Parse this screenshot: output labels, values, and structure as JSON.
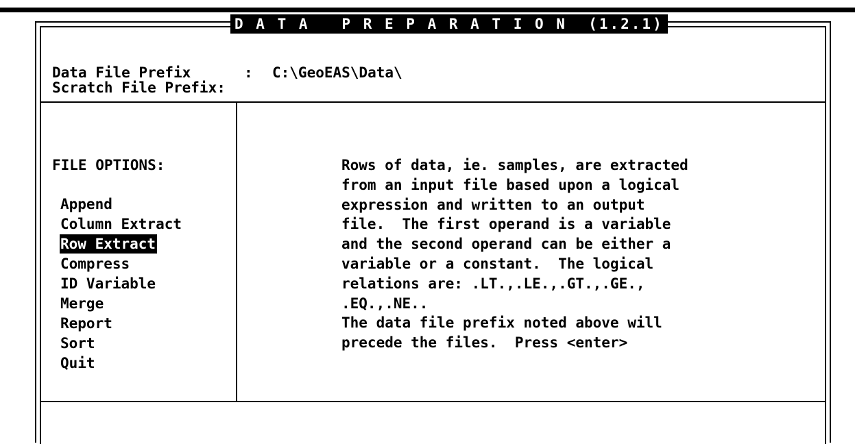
{
  "window": {
    "title": "D A T A   P R E P A R A T I O N  (1.2.1)"
  },
  "header": {
    "data_file_prefix_label": "Data File Prefix",
    "data_file_prefix_separator": ":",
    "data_file_prefix_value": "C:\\GeoEAS\\Data\\",
    "scratch_file_prefix_label": "Scratch File Prefix:",
    "scratch_file_prefix_value": ""
  },
  "file_options": {
    "heading": "FILE OPTIONS:",
    "items": [
      {
        "label": "Append",
        "selected": false
      },
      {
        "label": "Column Extract",
        "selected": false
      },
      {
        "label": "Row Extract",
        "selected": true
      },
      {
        "label": "Compress",
        "selected": false
      },
      {
        "label": "ID Variable",
        "selected": false
      },
      {
        "label": "Merge",
        "selected": false
      },
      {
        "label": "Report",
        "selected": false
      },
      {
        "label": "Sort",
        "selected": false
      },
      {
        "label": "Quit",
        "selected": false
      }
    ]
  },
  "description": {
    "lines": [
      "Rows of data, ie. samples, are extracted",
      "from an input file based upon a logical",
      "expression and written to an output",
      "file.  The first operand is a variable",
      "and the second operand can be either a",
      "variable or a constant.  The logical",
      "relations are: .LT.,.LE.,.GT.,.GE.,",
      ".EQ.,.NE..",
      "The data file prefix noted above will",
      "precede the files.  Press <enter>"
    ]
  },
  "status_bar": {
    "text": ""
  },
  "colors": {
    "background": "#ffffff",
    "foreground": "#000000",
    "highlight_bg": "#000000",
    "highlight_fg": "#ffffff"
  }
}
